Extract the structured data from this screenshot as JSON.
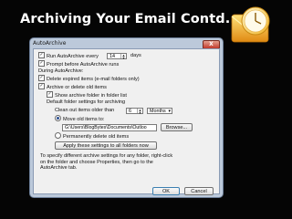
{
  "slide": {
    "title": "Archiving Your Email Contd.."
  },
  "logo": {
    "icon": "outlook-clock-logo"
  },
  "dialog": {
    "title": "AutoArchive",
    "close": "X",
    "run_every_label": "Run AutoArchive every",
    "run_every_value": "14",
    "run_every_unit": "days",
    "prompt_label": "Prompt before AutoArchive runs",
    "during_label": "During AutoArchive:",
    "delete_expired_label": "Delete expired items (e-mail folders only)",
    "archive_delete_label": "Archive or delete old items",
    "show_folder_label": "Show archive folder in folder list",
    "default_settings_label": "Default folder settings for archiving",
    "clean_label": "Clean out items older than",
    "clean_value": "6",
    "clean_unit": "Months",
    "move_label": "Move old items to:",
    "path_value": "G:\\Users\\BlogBytes\\Documents\\Outloo",
    "browse_label": "Browse...",
    "permanent_label": "Permanently delete old items",
    "apply_label": "Apply these settings to all folders now",
    "help_text": "To specify different archive settings for any folder, right-click on the folder and choose Properties, then go to the AutoArchive tab.",
    "ok_label": "OK",
    "cancel_label": "Cancel",
    "checkmark": "✓"
  },
  "colors": {
    "background": "#050505",
    "dialog_frame": "#bcc9da",
    "dialog_body": "#f0f0f0"
  }
}
